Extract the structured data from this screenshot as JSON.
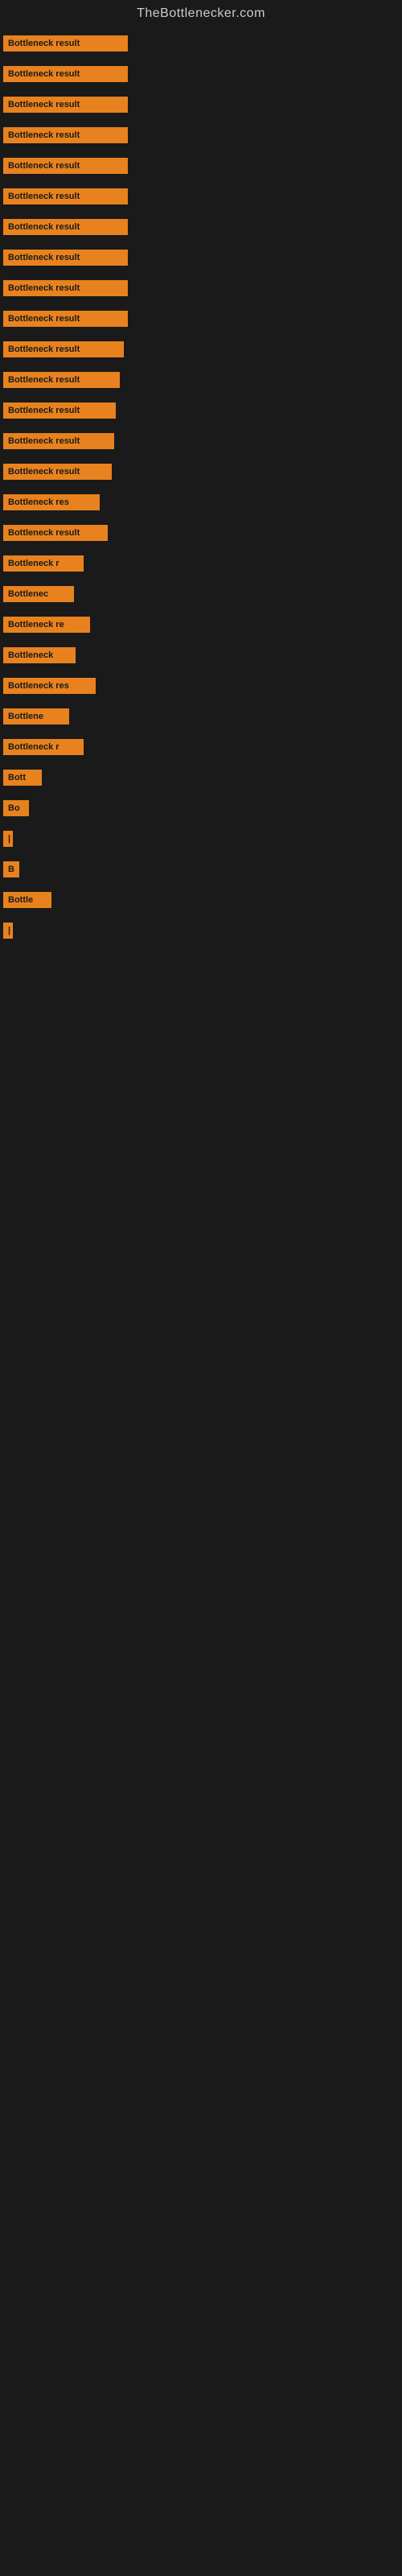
{
  "site": {
    "title": "TheBottlenecker.com"
  },
  "bars": [
    {
      "label": "Bottleneck result",
      "width": 155
    },
    {
      "label": "Bottleneck result",
      "width": 155
    },
    {
      "label": "Bottleneck result",
      "width": 155
    },
    {
      "label": "Bottleneck result",
      "width": 155
    },
    {
      "label": "Bottleneck result",
      "width": 155
    },
    {
      "label": "Bottleneck result",
      "width": 155
    },
    {
      "label": "Bottleneck result",
      "width": 155
    },
    {
      "label": "Bottleneck result",
      "width": 155
    },
    {
      "label": "Bottleneck result",
      "width": 155
    },
    {
      "label": "Bottleneck result",
      "width": 155
    },
    {
      "label": "Bottleneck result",
      "width": 150
    },
    {
      "label": "Bottleneck result",
      "width": 145
    },
    {
      "label": "Bottleneck result",
      "width": 140
    },
    {
      "label": "Bottleneck result",
      "width": 138
    },
    {
      "label": "Bottleneck result",
      "width": 135
    },
    {
      "label": "Bottleneck res",
      "width": 120
    },
    {
      "label": "Bottleneck result",
      "width": 130
    },
    {
      "label": "Bottleneck r",
      "width": 100
    },
    {
      "label": "Bottlenec",
      "width": 88
    },
    {
      "label": "Bottleneck re",
      "width": 108
    },
    {
      "label": "Bottleneck",
      "width": 90
    },
    {
      "label": "Bottleneck res",
      "width": 115
    },
    {
      "label": "Bottlene",
      "width": 82
    },
    {
      "label": "Bottleneck r",
      "width": 100
    },
    {
      "label": "Bott",
      "width": 48
    },
    {
      "label": "Bo",
      "width": 32
    },
    {
      "label": "|",
      "width": 10
    },
    {
      "label": "B",
      "width": 20
    },
    {
      "label": "Bottle",
      "width": 60
    },
    {
      "label": "|",
      "width": 8
    }
  ],
  "colors": {
    "bar_bg": "#e8821e",
    "bar_text": "#1a1a1a",
    "site_title": "#cccccc",
    "page_bg": "#1a1a1a"
  }
}
